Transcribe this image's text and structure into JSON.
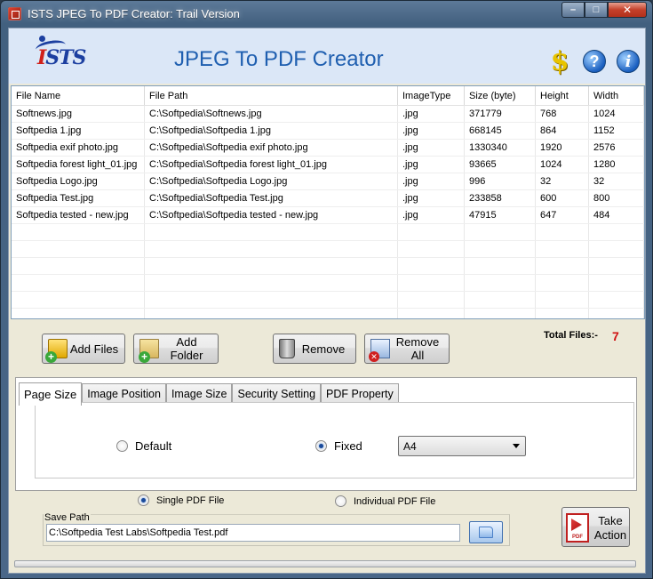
{
  "window": {
    "title": "ISTS JPEG To PDF Creator: Trail Version",
    "controls": {
      "minimize": "–",
      "maximize": "□",
      "close": "✕"
    }
  },
  "header": {
    "logo_text": "ISTS",
    "title": "JPEG To PDF Creator",
    "icons": [
      "dollar-icon",
      "help-icon",
      "info-icon"
    ],
    "dollar_glyph": "$",
    "help_glyph": "?",
    "info_glyph": "i",
    "accent_color": "#1f5fb0"
  },
  "file_table": {
    "columns": [
      "File Name",
      "File Path",
      "ImageType",
      "Size (byte)",
      "Height",
      "Width"
    ],
    "rows": [
      [
        "Softnews.jpg",
        "C:\\Softpedia\\Softnews.jpg",
        ".jpg",
        "371779",
        "768",
        "1024"
      ],
      [
        "Softpedia 1.jpg",
        "C:\\Softpedia\\Softpedia 1.jpg",
        ".jpg",
        "668145",
        "864",
        "1152"
      ],
      [
        "Softpedia exif photo.jpg",
        "C:\\Softpedia\\Softpedia exif photo.jpg",
        ".jpg",
        "1330340",
        "1920",
        "2576"
      ],
      [
        "Softpedia forest light_01.jpg",
        "C:\\Softpedia\\Softpedia forest light_01.jpg",
        ".jpg",
        "93665",
        "1024",
        "1280"
      ],
      [
        "Softpedia Logo.jpg",
        "C:\\Softpedia\\Softpedia Logo.jpg",
        ".jpg",
        "996",
        "32",
        "32"
      ],
      [
        "Softpedia Test.jpg",
        "C:\\Softpedia\\Softpedia Test.jpg",
        ".jpg",
        "233858",
        "600",
        "800"
      ],
      [
        "Softpedia tested - new.jpg",
        "C:\\Softpedia\\Softpedia tested - new.jpg",
        ".jpg",
        "47915",
        "647",
        "484"
      ]
    ]
  },
  "actions": {
    "add_files": "Add Files",
    "add_folder": "Add Folder",
    "remove": "Remove",
    "remove_all": "Remove All"
  },
  "total": {
    "label": "Total Files:-",
    "value": "7"
  },
  "tabs": [
    "Page Size",
    "Image Position",
    "Image Size",
    "Security Setting",
    "PDF Property"
  ],
  "active_tab": "Page Size",
  "page_size": {
    "default_label": "Default",
    "fixed_label": "Fixed",
    "selected": "fixed",
    "fixed_value": "A4"
  },
  "output_mode": {
    "single_label": "Single PDF File",
    "individual_label": "Individual PDF File",
    "selected": "single"
  },
  "save_path": {
    "label": "Save Path",
    "value": "C:\\Softpedia Test Labs\\Softpedia Test.pdf"
  },
  "take_action": {
    "line1": "Take",
    "line2": "Action",
    "pdf_badge": "PDF"
  }
}
